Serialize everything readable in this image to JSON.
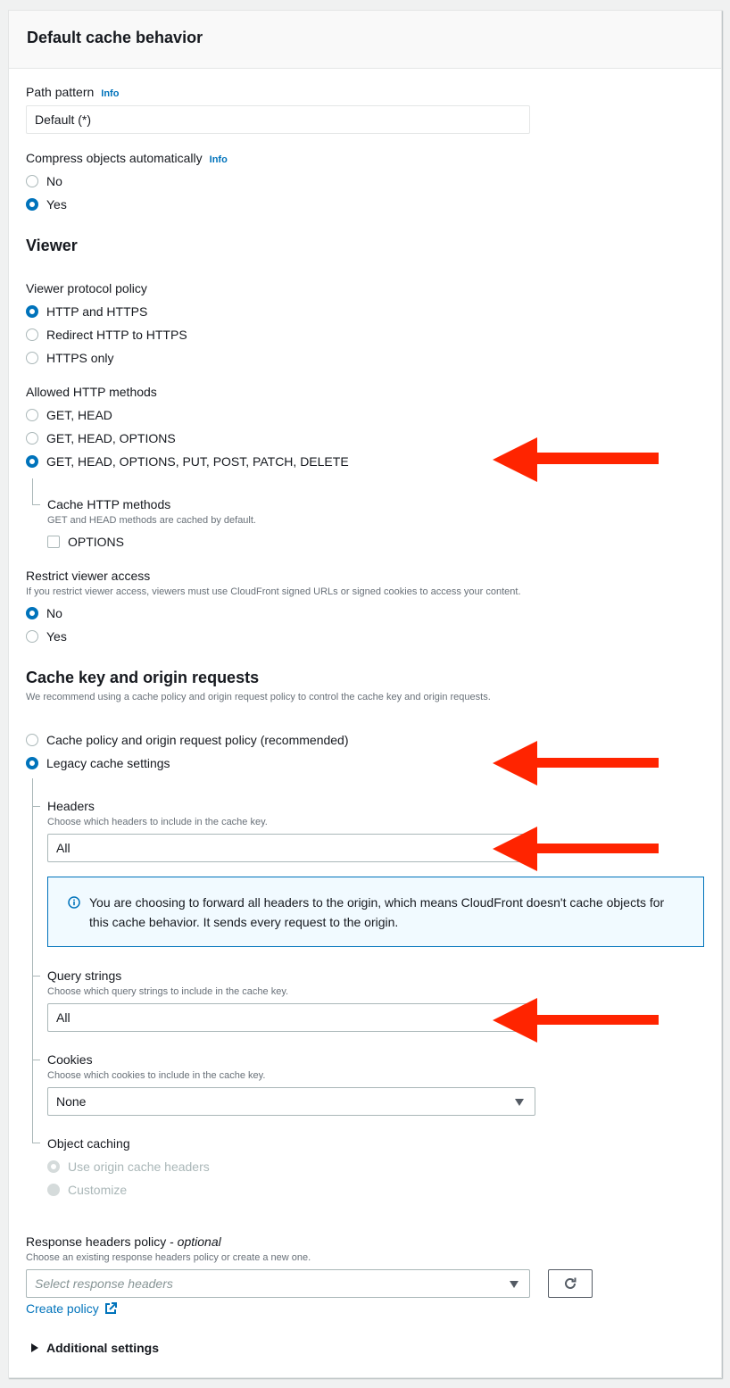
{
  "panel": {
    "title": "Default cache behavior"
  },
  "path_pattern": {
    "label": "Path pattern",
    "info": "Info",
    "value": "Default (*)"
  },
  "compress": {
    "label": "Compress objects automatically",
    "info": "Info",
    "options": [
      {
        "label": "No",
        "selected": false
      },
      {
        "label": "Yes",
        "selected": true
      }
    ]
  },
  "viewer": {
    "heading": "Viewer",
    "protocol_policy": {
      "label": "Viewer protocol policy",
      "options": [
        {
          "label": "HTTP and HTTPS",
          "selected": true
        },
        {
          "label": "Redirect HTTP to HTTPS",
          "selected": false
        },
        {
          "label": "HTTPS only",
          "selected": false
        }
      ]
    },
    "allowed_methods": {
      "label": "Allowed HTTP methods",
      "options": [
        {
          "label": "GET, HEAD",
          "selected": false
        },
        {
          "label": "GET, HEAD, OPTIONS",
          "selected": false
        },
        {
          "label": "GET, HEAD, OPTIONS, PUT, POST, PATCH, DELETE",
          "selected": true
        }
      ]
    },
    "cache_methods": {
      "label": "Cache HTTP methods",
      "description": "GET and HEAD methods are cached by default.",
      "options_checkbox": {
        "label": "OPTIONS",
        "checked": false
      }
    },
    "restrict_access": {
      "label": "Restrict viewer access",
      "description": "If you restrict viewer access, viewers must use CloudFront signed URLs or signed cookies to access your content.",
      "options": [
        {
          "label": "No",
          "selected": true
        },
        {
          "label": "Yes",
          "selected": false
        }
      ]
    }
  },
  "cache_key": {
    "heading": "Cache key and origin requests",
    "description": "We recommend using a cache policy and origin request policy to control the cache key and origin requests.",
    "options": [
      {
        "label": "Cache policy and origin request policy (recommended)",
        "selected": false
      },
      {
        "label": "Legacy cache settings",
        "selected": true
      }
    ],
    "headers": {
      "label": "Headers",
      "description": "Choose which headers to include in the cache key.",
      "value": "All"
    },
    "headers_alert": {
      "icon": "info-icon",
      "text_line1": "You are choosing to forward all headers to the origin, which means CloudFront doesn't cache objects for",
      "text_line2": "this cache behavior. It sends every request to the origin."
    },
    "query_strings": {
      "label": "Query strings",
      "description": "Choose which query strings to include in the cache key.",
      "value": "All"
    },
    "cookies": {
      "label": "Cookies",
      "description": "Choose which cookies to include in the cache key.",
      "value": "None"
    },
    "object_caching": {
      "label": "Object caching",
      "options": [
        {
          "label": "Use origin cache headers",
          "selected": true,
          "disabled": true
        },
        {
          "label": "Customize",
          "selected": false,
          "disabled": true
        }
      ]
    }
  },
  "response_headers": {
    "label": "Response headers policy",
    "label_suffix": "optional",
    "separator": " - ",
    "description": "Choose an existing response headers policy or create a new one.",
    "placeholder": "Select response headers",
    "create_link": "Create policy",
    "refresh_icon": "refresh-icon"
  },
  "additional_settings": {
    "label": "Additional settings",
    "expanded": false
  },
  "annotations": {
    "arrow_color": "#ff2400",
    "arrows": [
      "allowed-methods-selected",
      "legacy-cache-settings",
      "headers-all",
      "query-strings-all"
    ]
  }
}
